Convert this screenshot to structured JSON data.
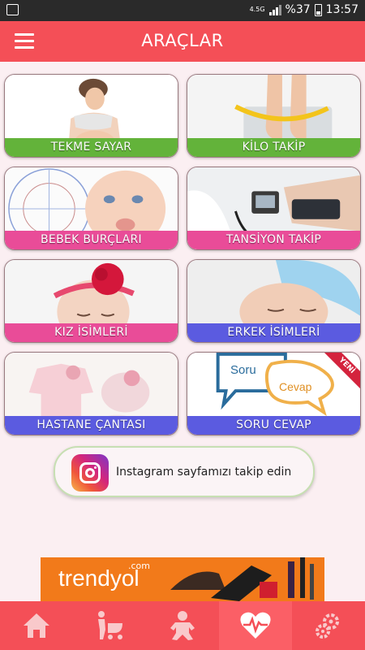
{
  "status_bar": {
    "network": "4.5G",
    "battery": "%37",
    "time": "13:57"
  },
  "header": {
    "title": "ARAÇLAR"
  },
  "tools": [
    {
      "label": "TEKME SAYAR",
      "color": "#63b33a"
    },
    {
      "label": "KİLO TAKİP",
      "color": "#63b33a"
    },
    {
      "label": "BEBEK BURÇLARI",
      "color": "#e94c98"
    },
    {
      "label": "TANSİYON TAKİP",
      "color": "#e94c98"
    },
    {
      "label": "KIZ İSİMLERİ",
      "color": "#e94c98"
    },
    {
      "label": "ERKEK İSİMLERİ",
      "color": "#5b5be0"
    },
    {
      "label": "HASTANE ÇANTASI",
      "color": "#5b5be0"
    },
    {
      "label": "SORU CEVAP",
      "color": "#5b5be0",
      "badge": "YENİ",
      "bubble_left": "Soru",
      "bubble_right": "Cevap"
    }
  ],
  "instagram": {
    "label": "Instagram sayfamızı takip edin"
  },
  "banner": {
    "brand": "trendyol",
    "suffix": ".com"
  },
  "bottom_nav": [
    {
      "icon": "home-icon"
    },
    {
      "icon": "stroller-icon"
    },
    {
      "icon": "baby-icon"
    },
    {
      "icon": "heartbeat-icon",
      "active": true
    },
    {
      "icon": "settings-icon"
    }
  ],
  "colors": {
    "primary": "#f44f57",
    "background": "#fbeff2"
  }
}
